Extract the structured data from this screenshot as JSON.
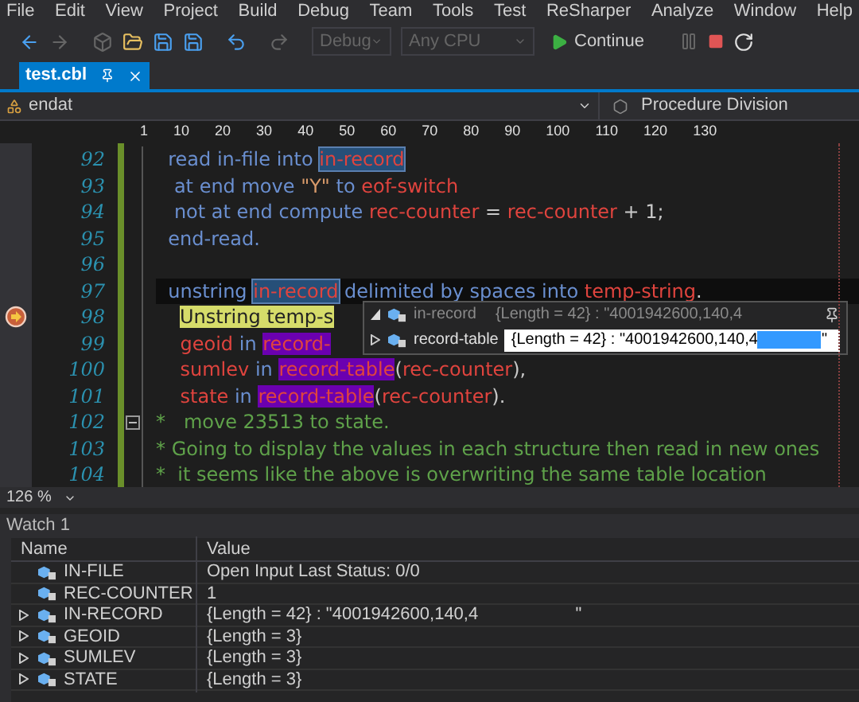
{
  "menu": [
    "File",
    "Edit",
    "View",
    "Project",
    "Build",
    "Debug",
    "Team",
    "Tools",
    "Test",
    "ReSharper",
    "Analyze",
    "Window",
    "Help"
  ],
  "toolbar": {
    "configuration": {
      "value": "Debug",
      "disabled": true
    },
    "platform": {
      "value": "Any CPU",
      "disabled": true
    },
    "continue": "Continue"
  },
  "tabs": [
    {
      "label": "test.cbl",
      "selected": true
    }
  ],
  "nav": {
    "left": "endat",
    "right": "Procedure Division"
  },
  "ruler": [
    "1",
    "10",
    "20",
    "30",
    "40",
    "50",
    "60",
    "70",
    "80",
    "90",
    "100",
    "110",
    "120",
    "130"
  ],
  "code_lines": [
    {
      "number": "92",
      "current": false,
      "execution": false,
      "collapsible": false,
      "tokens": [
        {
          "text": "  read in-file into ",
          "kind": "keyword"
        },
        {
          "text": "in-record",
          "kind": "identifier",
          "reference": true
        }
      ]
    },
    {
      "number": "93",
      "current": false,
      "execution": false,
      "collapsible": false,
      "tokens": [
        {
          "text": "   at end move ",
          "kind": "keyword"
        },
        {
          "text": "\"Y\"",
          "kind": "string"
        },
        {
          "text": " to ",
          "kind": "keyword"
        },
        {
          "text": "eof-switch",
          "kind": "identifier"
        }
      ]
    },
    {
      "number": "94",
      "current": false,
      "execution": false,
      "collapsible": false,
      "tokens": [
        {
          "text": "   not at end compute ",
          "kind": "keyword"
        },
        {
          "text": "rec-counter",
          "kind": "identifier"
        },
        {
          "text": " = ",
          "kind": "plain"
        },
        {
          "text": "rec-counter",
          "kind": "identifier"
        },
        {
          "text": " + 1;",
          "kind": "plain"
        }
      ]
    },
    {
      "number": "95",
      "current": false,
      "execution": false,
      "collapsible": false,
      "tokens": [
        {
          "text": "  end-read.",
          "kind": "keyword"
        }
      ]
    },
    {
      "number": "96",
      "current": false,
      "execution": false,
      "collapsible": false
    },
    {
      "number": "97",
      "current": true,
      "execution": false,
      "collapsible": false,
      "tokens": [
        {
          "text": "  unstring ",
          "kind": "keyword"
        },
        {
          "text": "in-record",
          "kind": "identifier",
          "reference": true
        },
        {
          "text": " delimited by spaces into ",
          "kind": "keyword"
        },
        {
          "text": "temp-string",
          "kind": "identifier"
        },
        {
          "text": ".",
          "kind": "plain"
        }
      ]
    },
    {
      "number": "98",
      "current": false,
      "execution": true,
      "collapsible": false,
      "tokens": [
        {
          "text": "Unstring temp-s",
          "kind": "plain",
          "execution": true
        }
      ]
    },
    {
      "number": "99",
      "current": false,
      "execution": false,
      "collapsible": false,
      "tokens": [
        {
          "text": "    geoid",
          "kind": "identifier"
        },
        {
          "text": " in ",
          "kind": "keyword"
        },
        {
          "text": "record-",
          "kind": "identifier",
          "match": true
        }
      ]
    },
    {
      "number": "100",
      "current": false,
      "execution": false,
      "collapsible": false,
      "tokens": [
        {
          "text": "    sumlev",
          "kind": "identifier"
        },
        {
          "text": " in ",
          "kind": "keyword"
        },
        {
          "text": "record-table",
          "kind": "identifier",
          "match": true
        },
        {
          "text": "(",
          "kind": "plain"
        },
        {
          "text": "rec-counter",
          "kind": "identifier"
        },
        {
          "text": "),",
          "kind": "plain"
        }
      ]
    },
    {
      "number": "101",
      "current": false,
      "execution": false,
      "collapsible": false,
      "tokens": [
        {
          "text": "    state",
          "kind": "identifier"
        },
        {
          "text": " in ",
          "kind": "keyword"
        },
        {
          "text": "record-table",
          "kind": "identifier",
          "match": true
        },
        {
          "text": "(",
          "kind": "plain"
        },
        {
          "text": "rec-counter",
          "kind": "identifier"
        },
        {
          "text": ").",
          "kind": "plain"
        }
      ]
    },
    {
      "number": "102",
      "current": false,
      "execution": false,
      "collapsible": true,
      "tokens": [
        {
          "text": "*   move 23513 to state.",
          "kind": "comment"
        }
      ]
    },
    {
      "number": "103",
      "current": false,
      "execution": false,
      "collapsible": false,
      "tokens": [
        {
          "text": "* Going to display the values in each structure then read in new ones",
          "kind": "comment"
        }
      ]
    },
    {
      "number": "104",
      "current": false,
      "execution": false,
      "collapsible": false,
      "tokens": [
        {
          "text": "*  it seems like the above is overwriting the same table location",
          "kind": "comment"
        }
      ]
    }
  ],
  "datatip": {
    "header": {
      "name": "in-record",
      "value": "{Length = 42} : \"4001942600,140,4"
    },
    "row": {
      "name": "record-table",
      "value": "{Length = 42} : \"4001942600,140,4",
      "selection": true,
      "value_end": "\""
    }
  },
  "zoom": "126 %",
  "watch": {
    "title": "Watch 1",
    "columns": [
      "Name",
      "Value"
    ],
    "rows": [
      {
        "name": "IN-FILE",
        "value": "Open Input Last Status: 0/0",
        "expandable": false
      },
      {
        "name": "REC-COUNTER",
        "value": "1",
        "expandable": false
      },
      {
        "name": "IN-RECORD",
        "value": "{Length = 42} : \"4001942600,140,4                    \"",
        "expandable": true
      },
      {
        "name": "GEOID",
        "value": "{Length = 3}",
        "expandable": true
      },
      {
        "name": "SUMLEV",
        "value": "{Length = 3}",
        "expandable": true
      },
      {
        "name": "STATE",
        "value": "{Length = 3}",
        "expandable": true
      }
    ]
  }
}
